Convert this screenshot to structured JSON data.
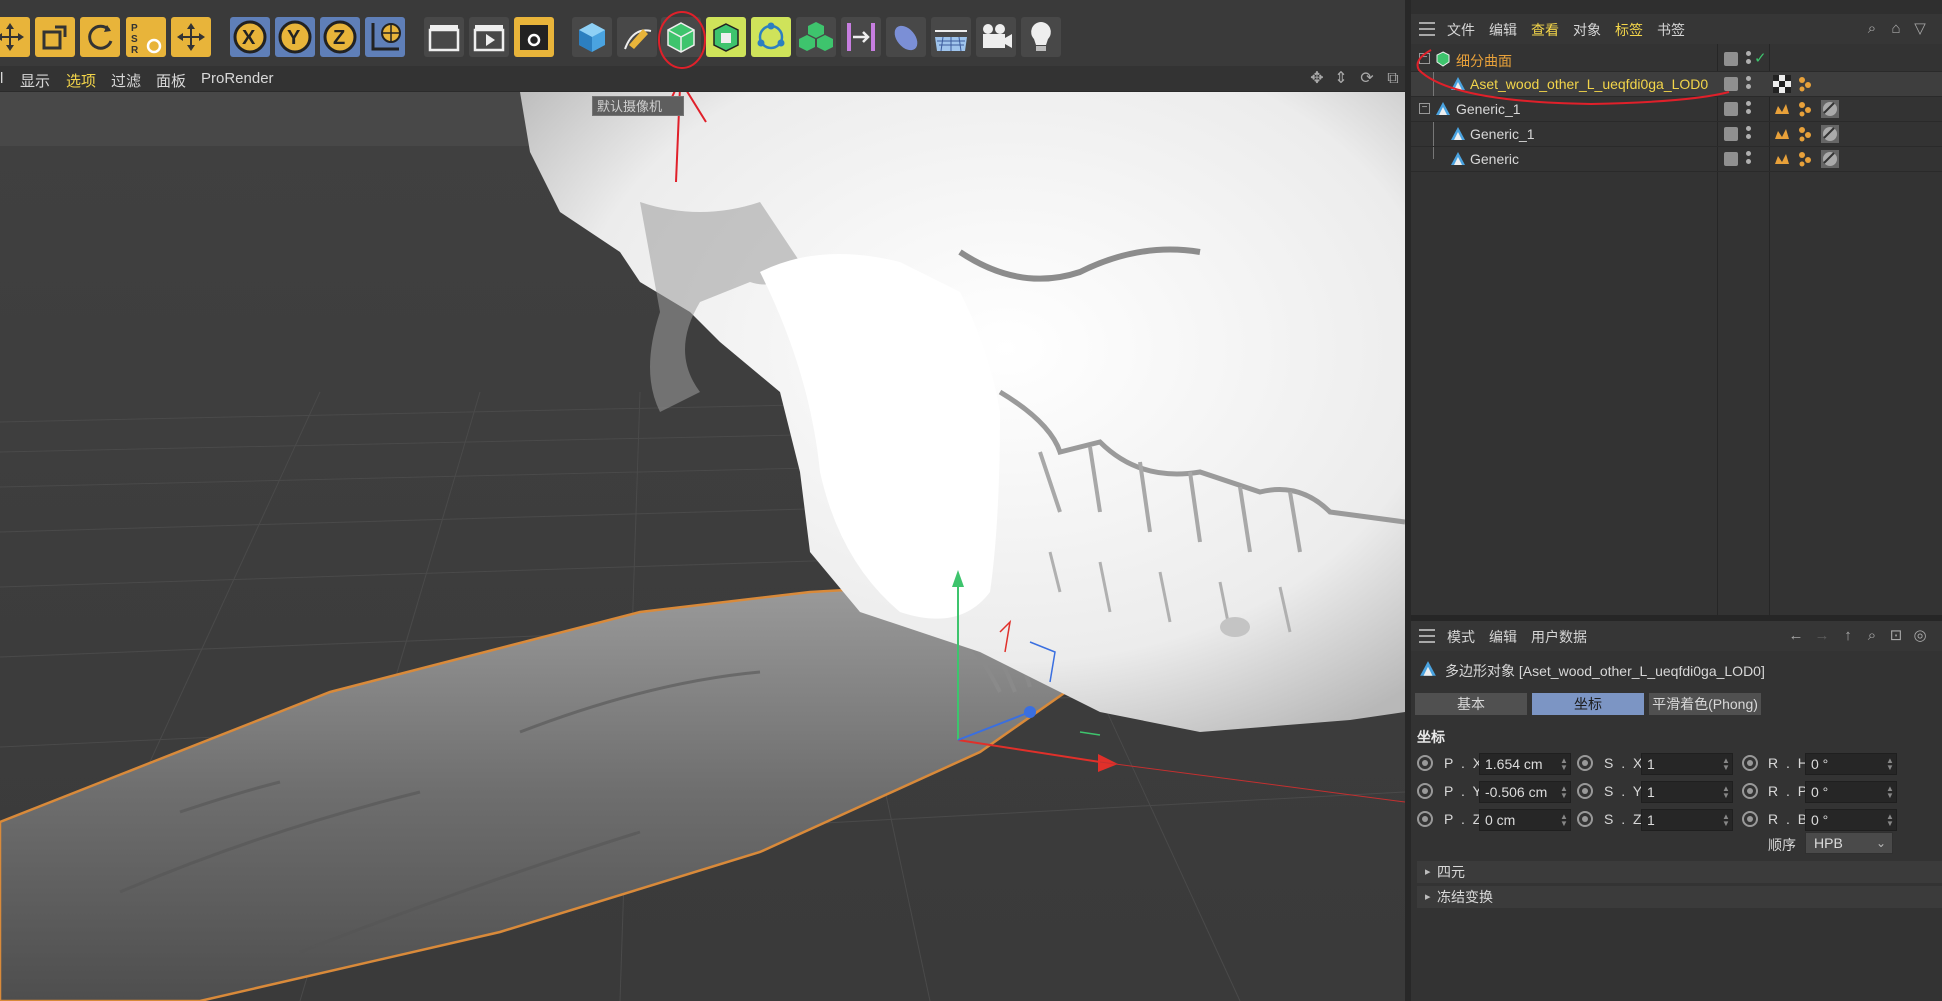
{
  "viewport_menu": {
    "items": [
      "l",
      "显示",
      "选项",
      "过滤",
      "面板",
      "ProRender"
    ],
    "active_index": 2,
    "camera_label": "默认摄像机"
  },
  "object_manager": {
    "menu": [
      "文件",
      "编辑",
      "查看",
      "对象",
      "标签",
      "书签"
    ],
    "highlight_menu_index": [
      2,
      4
    ],
    "objects": [
      {
        "name": "细分曲面",
        "color": "#e8a13a",
        "icon": "subdivision-surface-icon"
      },
      {
        "name": "Aset_wood_other_L_ueqfdi0ga_LOD0",
        "color": "#f3d54a",
        "icon": "polygon-object-icon"
      },
      {
        "name": "Generic_1",
        "color": "#d8d8d8",
        "icon": "polygon-object-icon"
      },
      {
        "name": "Generic_1",
        "color": "#d8d8d8",
        "icon": "polygon-object-icon"
      },
      {
        "name": "Generic",
        "color": "#d8d8d8",
        "icon": "polygon-object-icon"
      }
    ]
  },
  "attribute_manager": {
    "menu": [
      "模式",
      "编辑",
      "用户数据"
    ],
    "title": "多边形对象 [Aset_wood_other_L_ueqfdi0ga_LOD0]",
    "tabs": [
      "基本",
      "坐标",
      "平滑着色(Phong)"
    ],
    "active_tab_index": 1,
    "section": "坐标",
    "fields": {
      "px_label": "P . X",
      "px": "1.654 cm",
      "py_label": "P . Y",
      "py": "-0.506 cm",
      "pz_label": "P . Z",
      "pz": "0 cm",
      "sx_label": "S . X",
      "sx": "1",
      "sy_label": "S . Y",
      "sy": "1",
      "sz_label": "S . Z",
      "sz": "1",
      "rh_label": "R . H",
      "rh": "0 °",
      "rp_label": "R . P",
      "rp": "0 °",
      "rb_label": "R . B",
      "rb": "0 °"
    },
    "order_label": "顺序",
    "order_value": "HPB",
    "groups": [
      "四元",
      "冻结变换"
    ]
  },
  "colors": {
    "accent_yellow": "#f3d54a",
    "selection_orange": "#e8a13a",
    "active_tab": "#7c95c4",
    "annotation_red": "#e0202a"
  }
}
